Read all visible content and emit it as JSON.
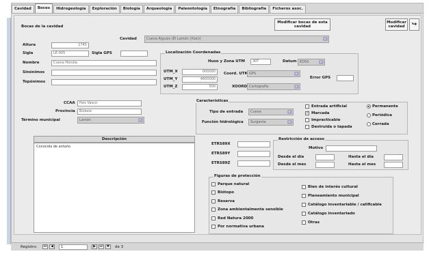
{
  "tabs": [
    "Cavidad",
    "Boces",
    "Hidrogeología",
    "Exploración",
    "Biología",
    "Arqueología",
    "Paleontología",
    "Etnografía",
    "Bibliografía",
    "Ficheros asoc."
  ],
  "active_tab": 1,
  "form": {
    "title": "Bocas de la cavidad",
    "btn_modify_bocas": "Modificar bocas de esta cavidad",
    "btn_modify_cavidad": "Modificar cavidad",
    "cavidad_label": "Cavidad",
    "cavidad_value": "Cueva Aiguiss (El Lamón (Xóxi))",
    "fields": {
      "altura": {
        "label": "Altura",
        "value": "1745"
      },
      "sigla": {
        "label": "Sigla",
        "value": "LE-005"
      },
      "sigla_gps": {
        "label": "Sigla GPS",
        "value": ""
      },
      "nombre": {
        "label": "Nombre",
        "value": "Cueva Hondia"
      },
      "sinonimos": {
        "label": "Sinónimos",
        "value": ""
      },
      "toponimos": {
        "label": "Topónimos",
        "value": ""
      }
    },
    "localizacion": {
      "title": "Localización Coordenadas",
      "huso_label": "Huso y Zona UTM",
      "huso_value": "30T",
      "datum_label": "Datum",
      "datum_value": "ED50",
      "utmx_label": "UTM_X",
      "utmx_value": "000000",
      "utmy_label": "UTM_Y",
      "utmy_value": "4600000",
      "utmz_label": "UTM_Z",
      "utmz_value": "500",
      "coord_label": "Coord. UTM",
      "coord_value": "GPS",
      "error_gps_label": "Error GPS",
      "error_gps_value": "",
      "xoord_label": "XOORD",
      "xoord_value": "Cartografía"
    },
    "admin": {
      "ccaa_label": "CCAA",
      "ccaa_value": "País Vasco",
      "provincia_label": "Provincia",
      "provincia_value": "Bizkaia",
      "termino_label": "Término municipal",
      "termino_value": "Lamón"
    },
    "caracteristicas": {
      "title": "Características",
      "tipo_label": "Tipo de entrada",
      "tipo_value": "Cueva",
      "funcion_label": "Función hidrológica",
      "funcion_value": "Surgente",
      "checks": [
        {
          "label": "Entrada artificial",
          "checked": false
        },
        {
          "label": "Marcada",
          "checked": true
        },
        {
          "label": "Impracticable",
          "checked": false
        },
        {
          "label": "Destruida o tapada",
          "checked": false
        }
      ],
      "radios": [
        {
          "label": "Permanente",
          "checked": true
        },
        {
          "label": "Periódica",
          "checked": false
        },
        {
          "label": "Cerrada",
          "checked": false
        }
      ]
    },
    "descripcion": {
      "header": "Descripción",
      "text": "Conocida de antaño"
    },
    "etrs": [
      {
        "label": "ETRS89X",
        "value": ""
      },
      {
        "label": "ETRS89Y",
        "value": ""
      },
      {
        "label": "ETRS89Z",
        "value": ""
      }
    ],
    "restriccion": {
      "title": "Restricción de acceso",
      "motivo_label": "Motivo",
      "motivo_value": "",
      "desde_dia_label": "Desde el día",
      "desde_dia_value": "",
      "hasta_dia_label": "Hasta el día",
      "hasta_dia_value": "",
      "desde_hora_label": "Desde el mes",
      "desde_hora_value": "",
      "hasta_hora_label": "Hasta el mes",
      "hasta_hora_value": ""
    },
    "proteccion": {
      "title": "Figuras de protección",
      "left": [
        {
          "label": "Parque natural",
          "checked": false
        },
        {
          "label": "Biótopo",
          "checked": false
        },
        {
          "label": "Reserva",
          "checked": false
        },
        {
          "label": "Zona ambientalmente sensible",
          "checked": false
        },
        {
          "label": "Red Natura 2000",
          "checked": false
        },
        {
          "label": "Por normativa urbana",
          "checked": false
        }
      ],
      "right": [
        {
          "label": "Bien de interés cultural",
          "checked": false
        },
        {
          "label": "Planeamiento municipal",
          "checked": false
        },
        {
          "label": "Catálogo inventariable / calificable",
          "checked": false
        },
        {
          "label": "Catálogo inventariado",
          "checked": false
        },
        {
          "label": "Otras",
          "checked": false
        }
      ]
    }
  },
  "navigator": {
    "label": "Registro:",
    "current": "1",
    "of_label": "de 3"
  },
  "colors": {
    "accent": "#a9a9c4",
    "panel": "#ebebeb",
    "frame": "#e4e4e4"
  }
}
